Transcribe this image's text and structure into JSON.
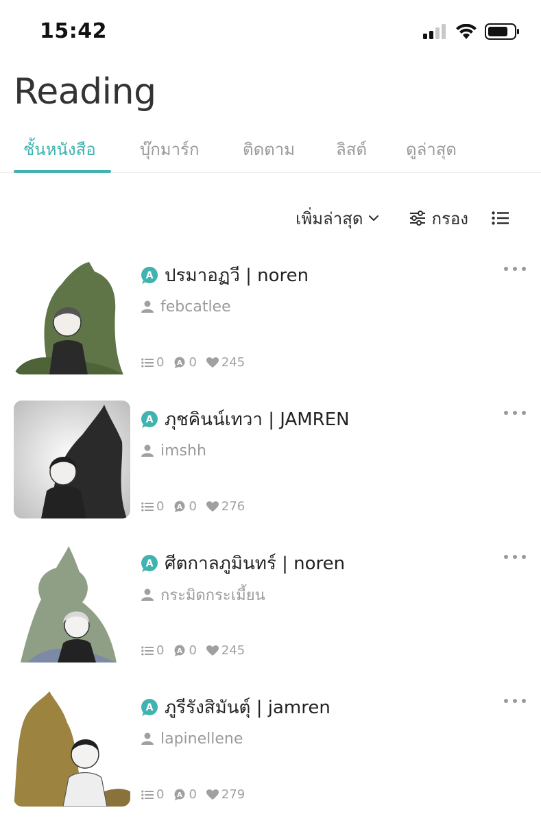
{
  "status_bar": {
    "time": "15:42"
  },
  "header": {
    "title": "Reading"
  },
  "tabs": [
    {
      "label": "ชั้นหนังสือ",
      "active": true
    },
    {
      "label": "บุ๊กมาร์ก",
      "active": false
    },
    {
      "label": "ติดตาม",
      "active": false
    },
    {
      "label": "ลิสต์",
      "active": false
    },
    {
      "label": "ดูล่าสุด",
      "active": false
    }
  ],
  "toolbar": {
    "sort_label": "เพิ่มล่าสุด",
    "filter_label": "กรอง"
  },
  "books": [
    {
      "title": "ปรมาอฏวี | noren",
      "author": "febcatlee",
      "lists": "0",
      "comments": "0",
      "likes": "245",
      "cover_color": "#5f7548"
    },
    {
      "title": "ภุชคินน์เทวา | JAMREN",
      "author": "imshh",
      "lists": "0",
      "comments": "0",
      "likes": "276",
      "cover_color": "#2a2a2a"
    },
    {
      "title": "ศีตกาลภูมินทร์ | noren",
      "author": "กระมิดกระเมี้ยน",
      "lists": "0",
      "comments": "0",
      "likes": "245",
      "cover_color": "#8f9f86"
    },
    {
      "title": "ภูรีรังสิมันตุ์ | jamren",
      "author": "lapinellene",
      "lists": "0",
      "comments": "0",
      "likes": "279",
      "cover_color": "#9c8440"
    }
  ],
  "colors": {
    "accent": "#3fb3b0",
    "muted": "#9a9a9a"
  },
  "icons": {
    "badge": "a-badge-icon",
    "author": "person-icon",
    "list": "list-icon",
    "comment": "comment-icon",
    "like": "heart-icon",
    "more": "more-dots-icon",
    "sort": "chevron-down-icon",
    "filter": "sliders-icon",
    "view": "list-view-icon"
  }
}
